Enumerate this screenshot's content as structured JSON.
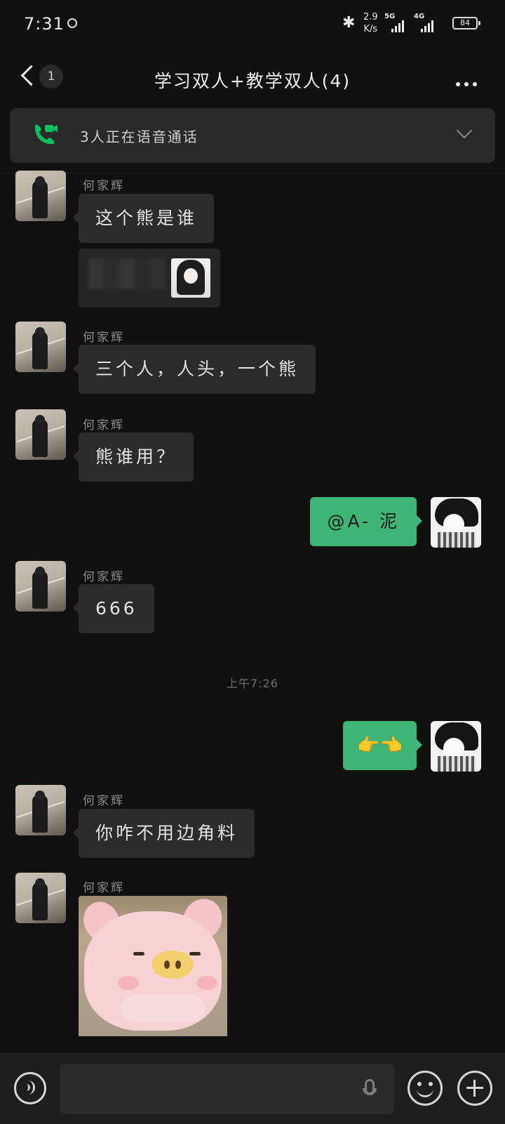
{
  "status_bar": {
    "time": "7:31",
    "net_speed_value": "2.9",
    "net_speed_unit": "K/s",
    "sim1_type": "5G",
    "sim2_type": "4G",
    "battery": "84"
  },
  "header": {
    "unread_count": "1",
    "title": "学习双人+教学双人(4)"
  },
  "call_banner": {
    "text": "3人正在语音通话",
    "accent_color": "#07c160"
  },
  "messages": [
    {
      "sender": "何家辉",
      "text": "这个熊是谁"
    },
    {
      "sender": "何家辉",
      "text": "三个人，人头，一个熊"
    },
    {
      "sender": "何家辉",
      "text": "熊谁用？"
    },
    {
      "text": "@A- 泥"
    },
    {
      "sender": "何家辉",
      "text": "666"
    },
    {
      "text": "👉👈"
    },
    {
      "sender": "何家辉",
      "text": "你咋不用边角料"
    },
    {
      "sender": "何家辉",
      "sticker": "pig-sticker"
    }
  ],
  "time_separator": "上午7:26",
  "input_bar": {
    "value": ""
  },
  "colors": {
    "background": "#111111",
    "bubble_other": "#2c2c2c",
    "bubble_self": "#3eb575"
  }
}
